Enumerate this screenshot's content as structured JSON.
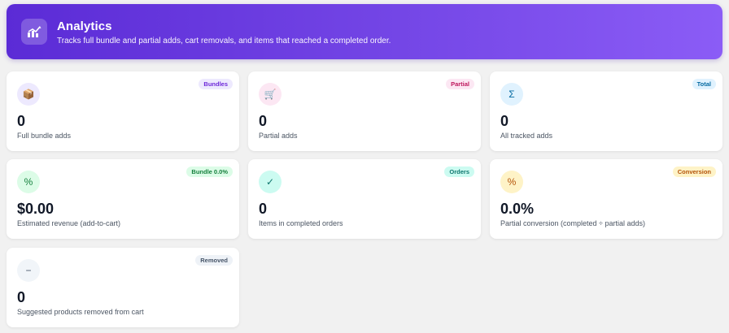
{
  "header": {
    "icon": "chart-icon",
    "title": "Analytics",
    "subtitle": "Tracks full bundle and partial adds, cart removals, and items that reached a completed order."
  },
  "cards": [
    {
      "icon": "package-icon",
      "icon_glyph": "📦",
      "badge": "Bundles",
      "value": "0",
      "label": "Full bundle adds",
      "icon_bg": "#ede9fe",
      "badge_bg": "#ede9fe",
      "badge_color": "#6d28d9"
    },
    {
      "icon": "cart-icon",
      "icon_glyph": "🛒",
      "badge": "Partial",
      "value": "0",
      "label": "Partial adds",
      "icon_bg": "#fce7f3",
      "badge_bg": "#fce7f3",
      "badge_color": "#be185d"
    },
    {
      "icon": "sigma-icon",
      "icon_glyph": "Σ",
      "badge": "Total",
      "value": "0",
      "label": "All tracked adds",
      "icon_bg": "#e0f2fe",
      "badge_bg": "#e0f2fe",
      "badge_color": "#0369a1"
    },
    {
      "icon": "percent-icon",
      "icon_glyph": "%",
      "badge": "Bundle 0.0%",
      "value": "$0.00",
      "label": "Estimated revenue (add-to-cart)",
      "icon_bg": "#dcfce7",
      "badge_bg": "#dcfce7",
      "badge_color": "#15803d"
    },
    {
      "icon": "checkmark-icon",
      "icon_glyph": "✓",
      "badge": "Orders",
      "value": "0",
      "label": "Items in completed orders",
      "icon_bg": "#ccfbf1",
      "badge_bg": "#ccfbf1",
      "badge_color": "#0f766e"
    },
    {
      "icon": "percent-icon",
      "icon_glyph": "%",
      "badge": "Conversion",
      "value": "0.0%",
      "label": "Partial conversion (completed ÷ partial adds)",
      "icon_bg": "#fef3c7",
      "badge_bg": "#fef3c7",
      "badge_color": "#b45309"
    },
    {
      "icon": "minus-icon",
      "icon_glyph": "−",
      "badge": "Removed",
      "value": "0",
      "label": "Suggested products removed from cart",
      "icon_bg": "#f1f5f9",
      "badge_bg": "#eef2f7",
      "badge_color": "#475569"
    }
  ]
}
